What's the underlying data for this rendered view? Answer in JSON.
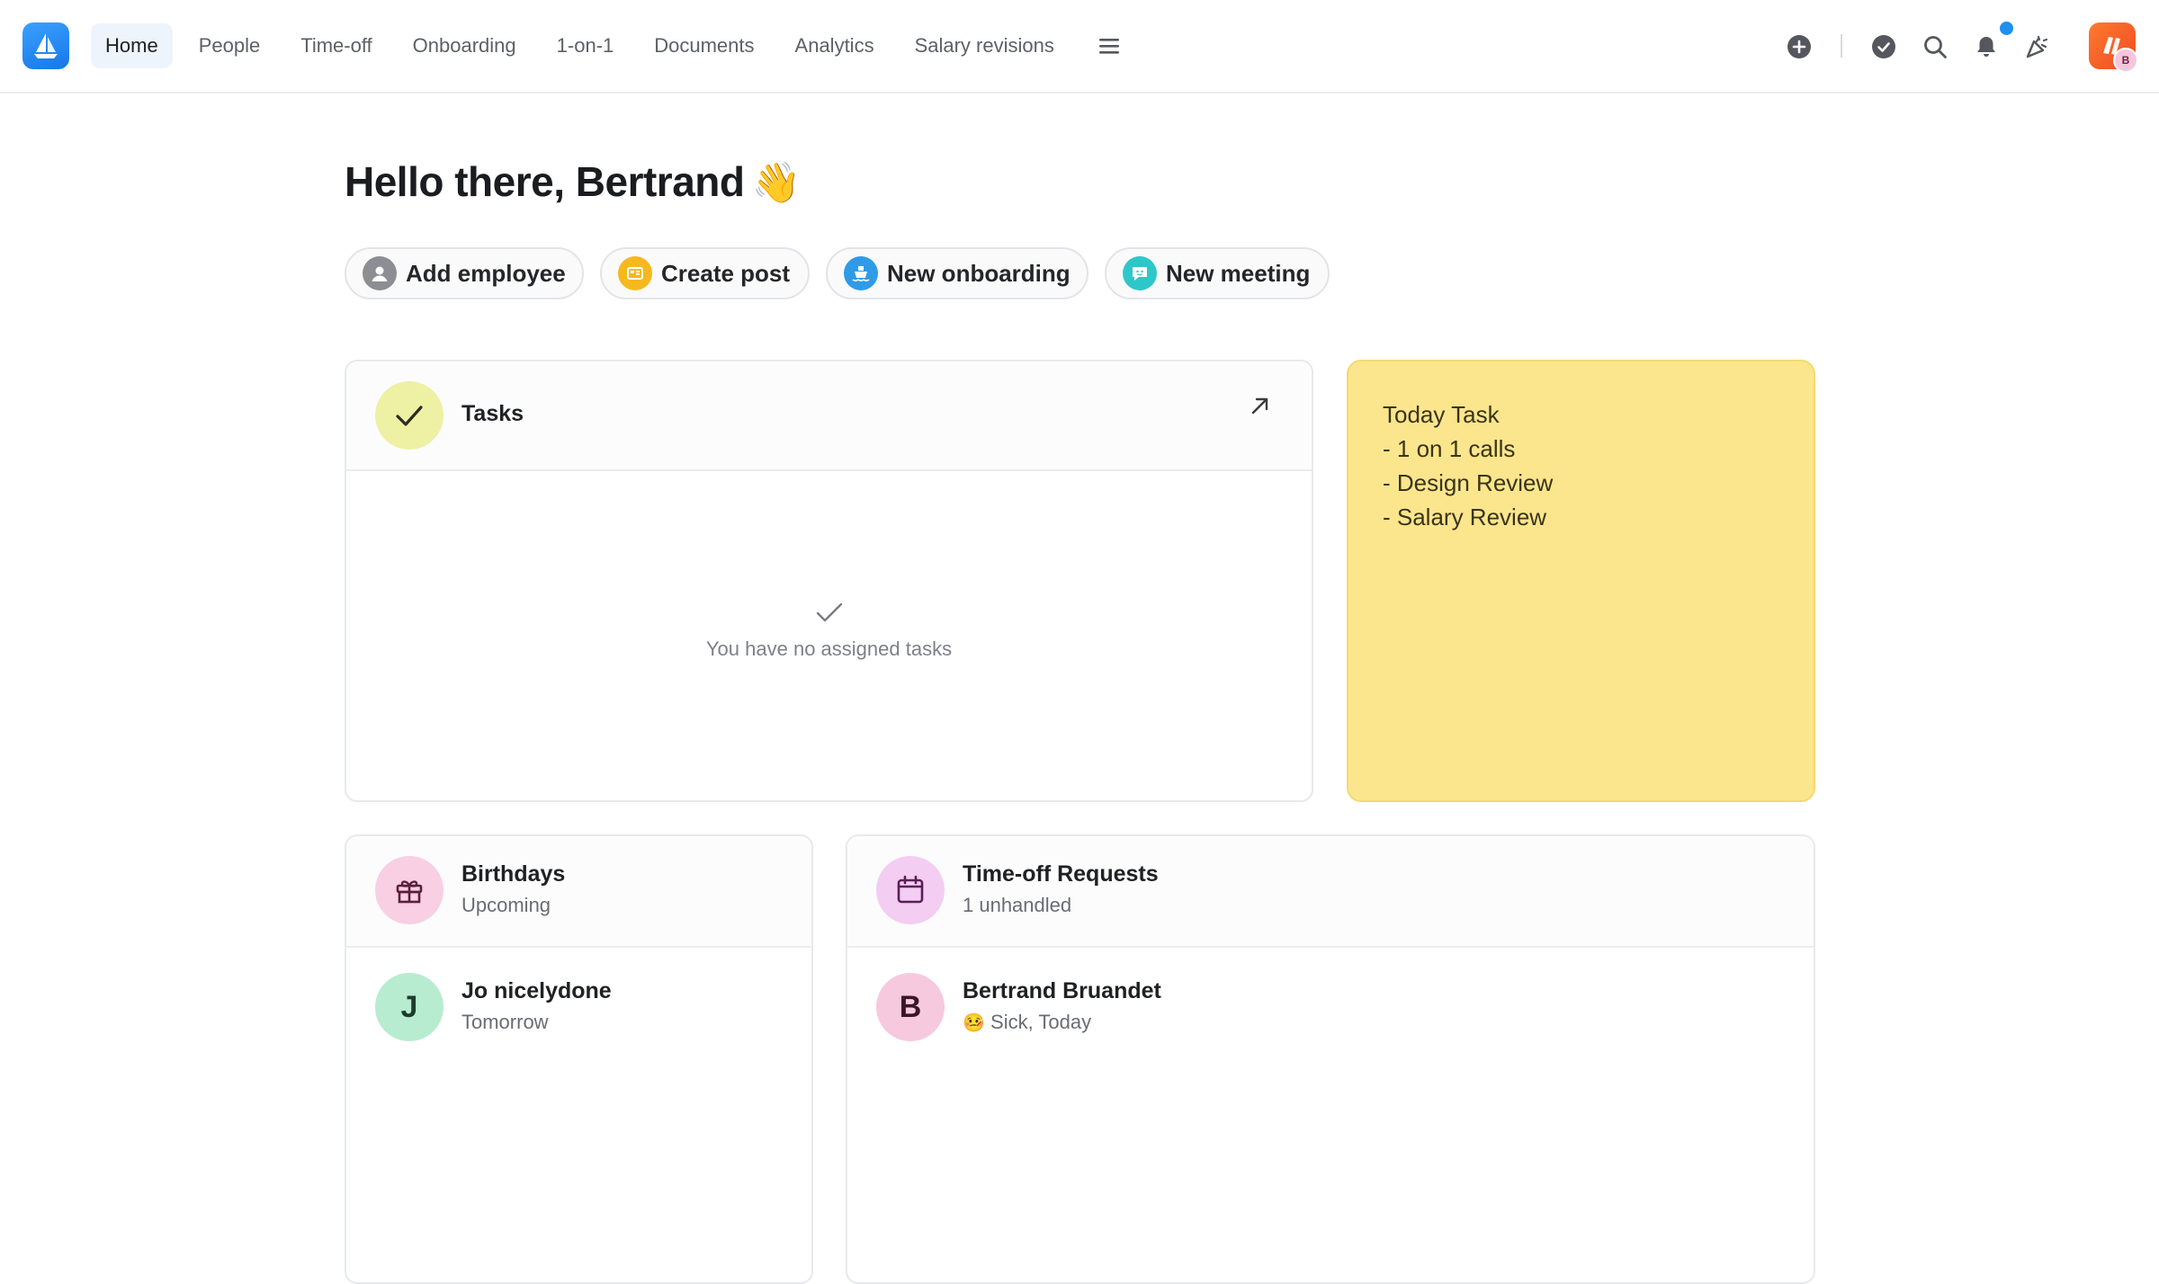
{
  "nav": {
    "items": [
      "Home",
      "People",
      "Time-off",
      "Onboarding",
      "1-on-1",
      "Documents",
      "Analytics",
      "Salary revisions"
    ],
    "active": "Home"
  },
  "user": {
    "initial": "B"
  },
  "greeting": {
    "text": "Hello there, Bertrand",
    "emoji": "👋"
  },
  "quick_actions": [
    {
      "label": "Add employee",
      "icon": "person-icon",
      "color": "#8d8e93"
    },
    {
      "label": "Create post",
      "icon": "post-icon",
      "color": "#f5b91e"
    },
    {
      "label": "New onboarding",
      "icon": "ship-icon",
      "color": "#2f9be8"
    },
    {
      "label": "New meeting",
      "icon": "chat-face-icon",
      "color": "#2ec7c9"
    }
  ],
  "tasks": {
    "title": "Tasks",
    "empty_text": "You have no assigned tasks",
    "accent": "#eef0a4"
  },
  "sticky_note": {
    "lines": [
      "Today Task",
      "- 1 on 1 calls",
      "- Design Review",
      "- Salary Review"
    ],
    "color": "#fbe68d"
  },
  "birthdays": {
    "title": "Birthdays",
    "subtitle": "Upcoming",
    "items": [
      {
        "initial": "J",
        "name": "Jo nicelydone",
        "detail": "Tomorrow"
      }
    ]
  },
  "timeoff": {
    "title": "Time-off Requests",
    "subtitle": "1 unhandled",
    "items": [
      {
        "initial": "B",
        "name": "Bertrand Bruandet",
        "emoji": "🤒",
        "detail": "Sick, Today"
      }
    ]
  }
}
